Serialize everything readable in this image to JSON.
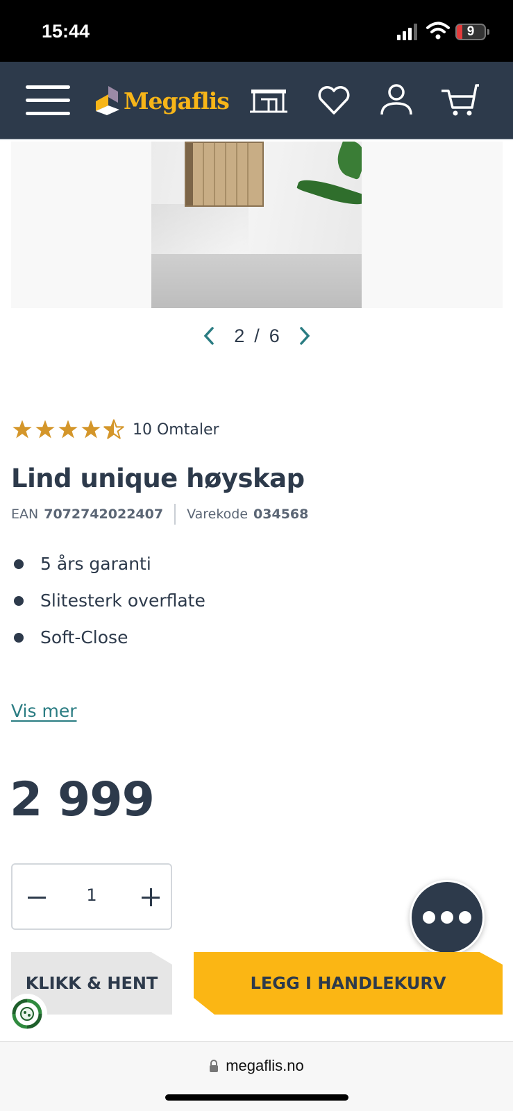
{
  "status_bar": {
    "time": "15:44",
    "battery": "9"
  },
  "header": {
    "brand": "Megaflis"
  },
  "gallery": {
    "current": "2",
    "separator": "/",
    "total": "6"
  },
  "product": {
    "rating": 4.5,
    "reviews": "10 Omtaler",
    "title": "Lind unique høyskap",
    "ean_label": "EAN",
    "ean": "7072742022407",
    "code_label": "Varekode",
    "code": "034568",
    "features": [
      "5 års garanti",
      "Slitesterk overflate",
      "Soft-Close"
    ],
    "more_link": "Vis mer",
    "price": "2 999",
    "quantity": "1"
  },
  "actions": {
    "click_collect": "KLIKK & HENT",
    "add_to_cart": "LEGG I HANDLEKURV"
  },
  "browser": {
    "url": "megaflis.no"
  },
  "colors": {
    "navy": "#2d3a4b",
    "yellow": "#fbb614",
    "star": "#d4962a",
    "link": "#2a7c82"
  }
}
